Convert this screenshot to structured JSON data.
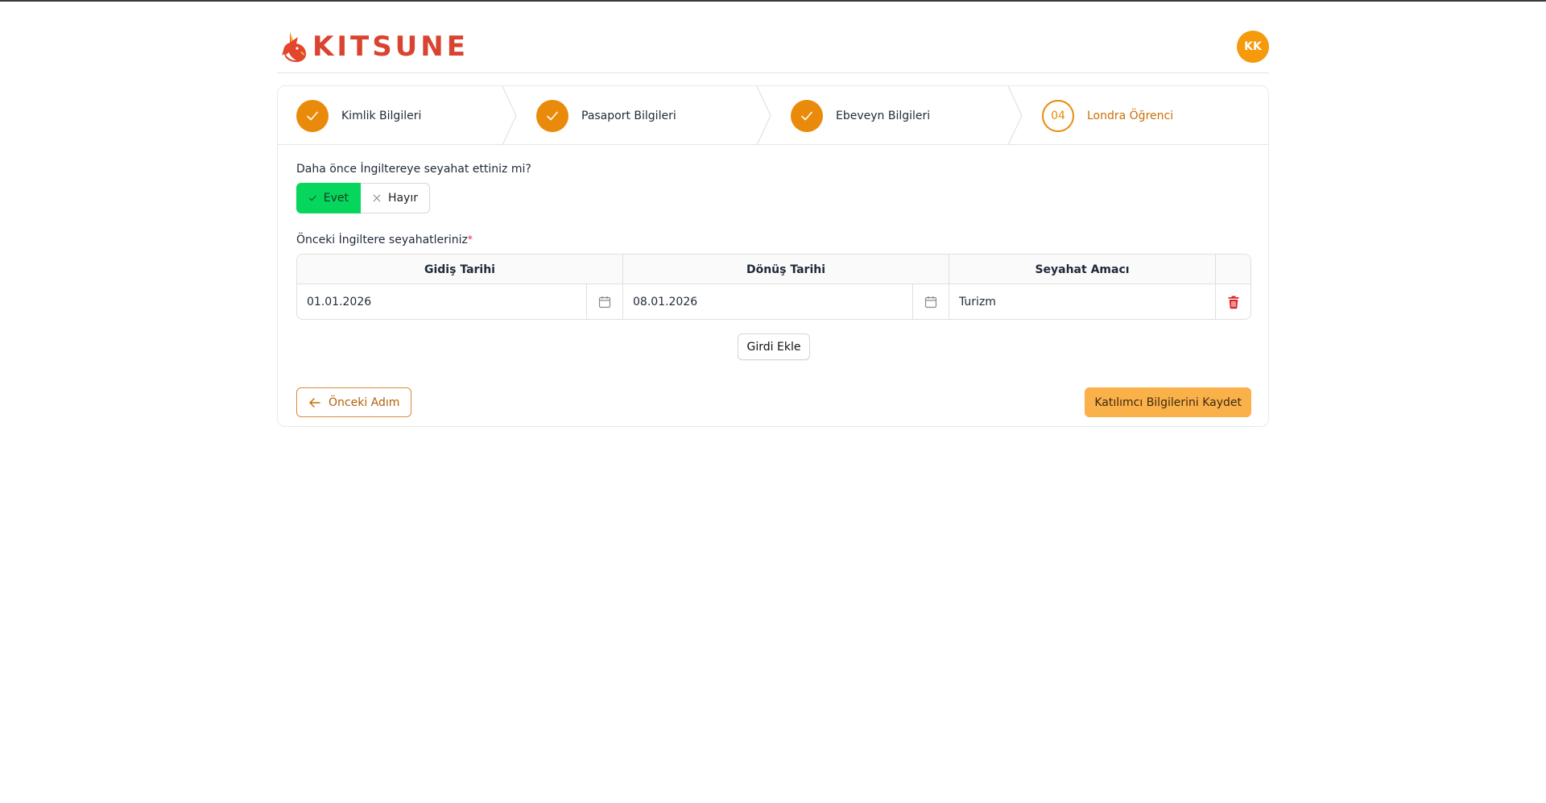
{
  "app": {
    "brand": "KITSUNE",
    "user_initials": "KK"
  },
  "colors": {
    "accent": "#ea8a0a",
    "brand": "#d9432f",
    "yes": "#06d65c",
    "delete": "#dc2626"
  },
  "steps": [
    {
      "label": "Kimlik Bilgileri",
      "status": "done"
    },
    {
      "label": "Pasaport Bilgileri",
      "status": "done"
    },
    {
      "label": "Ebeveyn Bilgileri",
      "status": "done"
    },
    {
      "number": "04",
      "label": "Londra Öğrenci",
      "status": "active"
    }
  ],
  "form": {
    "question": "Daha önce İngiltereye seyahat ettiniz mi?",
    "yes_label": "Evet",
    "no_label": "Hayır",
    "selected": "Evet",
    "previous_trips_label": "Önceki İngiltere seyahatleriniz",
    "required_mark": "*"
  },
  "table": {
    "headers": [
      "Gidiş Tarihi",
      "Dönüş Tarihi",
      "Seyahat Amacı"
    ],
    "rows": [
      {
        "departure": "01.01.2026",
        "return": "08.01.2026",
        "purpose": "Turizm"
      }
    ]
  },
  "actions": {
    "add_entry": "Girdi Ekle",
    "previous_step": "Önceki Adım",
    "save": "Katılımcı Bilgilerini Kaydet"
  }
}
